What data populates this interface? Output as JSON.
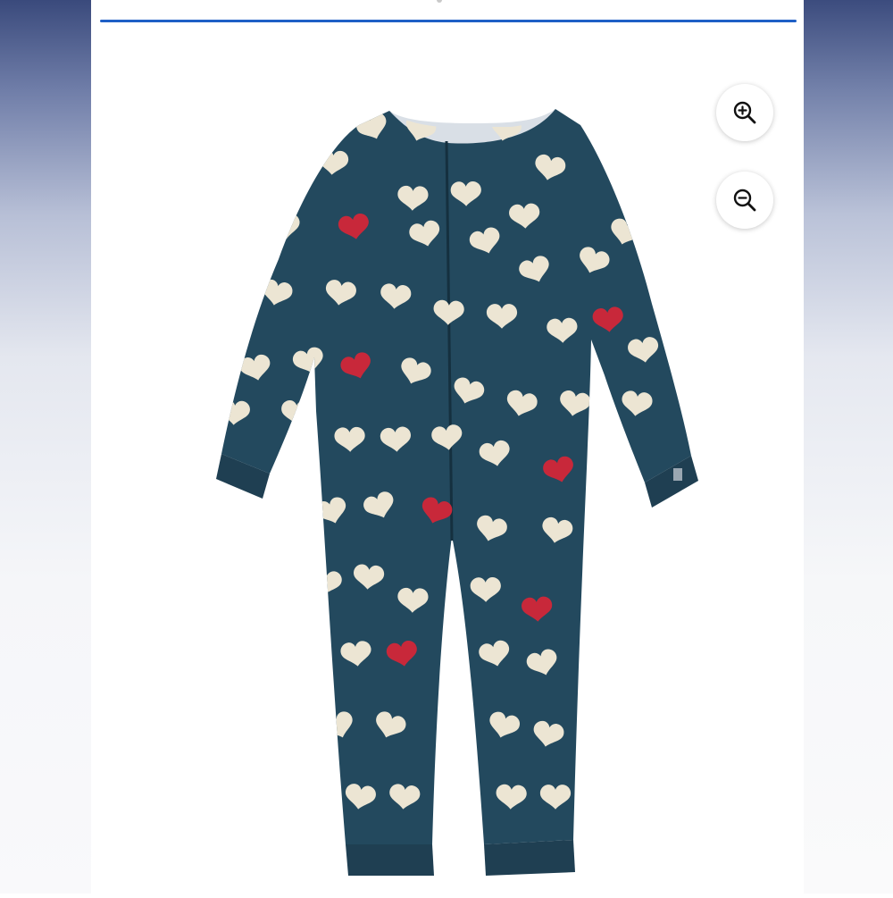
{
  "page": {
    "accent_color": "#1f5fc6",
    "fabric_color": "#23495e",
    "cuff_color": "#1f3f52",
    "heart_cream_color": "#ece5d3",
    "heart_red_color": "#c8283a"
  },
  "viewer": {
    "image_description_hidden": true,
    "zoom_in_icon": "zoom-in-icon",
    "zoom_out_icon": "zoom-out-icon"
  }
}
